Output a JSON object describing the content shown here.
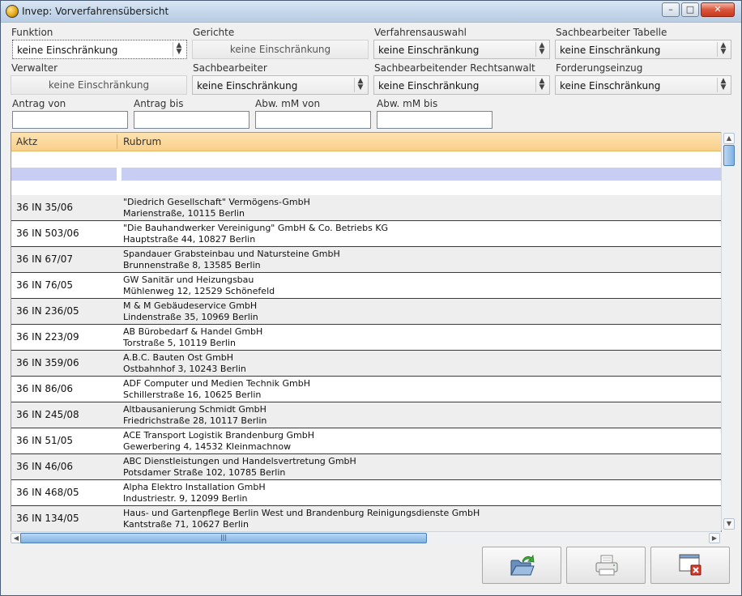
{
  "window": {
    "title": "Invep: Vorverfahrensübersicht"
  },
  "filters": {
    "funktion": {
      "label": "Funktion",
      "value": "keine Einschränkung"
    },
    "gerichte": {
      "label": "Gerichte",
      "value": "keine Einschränkung"
    },
    "verfahrensauswahl": {
      "label": "Verfahrensauswahl",
      "value": "keine Einschränkung"
    },
    "sachbearbeiter_tabelle": {
      "label": "Sachbearbeiter Tabelle",
      "value": "keine Einschränkung"
    },
    "verwalter": {
      "label": "Verwalter",
      "value": "keine Einschränkung"
    },
    "sachbearbeiter": {
      "label": "Sachbearbeiter",
      "value": "keine Einschränkung"
    },
    "sachbearbeitender_ra": {
      "label": "Sachbearbeitender Rechtsanwalt",
      "value": "keine Einschränkung"
    },
    "forderungseinzug": {
      "label": "Forderungseinzug",
      "value": "keine Einschränkung"
    },
    "antrag_von": {
      "label": "Antrag von",
      "value": ""
    },
    "antrag_bis": {
      "label": "Antrag bis",
      "value": ""
    },
    "abw_von": {
      "label": "Abw. mM von",
      "value": ""
    },
    "abw_bis": {
      "label": "Abw. mM bis",
      "value": ""
    }
  },
  "table": {
    "columns": [
      "Aktz",
      "Rubrum"
    ],
    "rows": [
      {
        "aktz": "36 IN 35/06",
        "line1": "\"Diedrich Gesellschaft\" Vermögens-GmbH",
        "line2": "Marienstraße, 10115 Berlin"
      },
      {
        "aktz": "36 IN 503/06",
        "line1": "\"Die Bauhandwerker Vereinigung\" GmbH & Co. Betriebs KG",
        "line2": "Hauptstraße 44, 10827 Berlin"
      },
      {
        "aktz": "36 IN 67/07",
        "line1": "Spandauer Grabsteinbau und Natursteine GmbH",
        "line2": "Brunnenstraße 8, 13585 Berlin"
      },
      {
        "aktz": "36 IN 76/05",
        "line1": "GW Sanitär und Heizungsbau",
        "line2": "Mühlenweg 12, 12529 Schönefeld"
      },
      {
        "aktz": "36 IN 236/05",
        "line1": "M & M Gebäudeservice GmbH",
        "line2": "Lindenstraße 35, 10969 Berlin"
      },
      {
        "aktz": "36 IN 223/09",
        "line1": "AB Bürobedarf & Handel GmbH",
        "line2": "Torstraße 5, 10119 Berlin"
      },
      {
        "aktz": "36 IN 359/06",
        "line1": "A.B.C. Bauten Ost GmbH",
        "line2": "Ostbahnhof 3, 10243 Berlin"
      },
      {
        "aktz": "36 IN 86/06",
        "line1": "ADF Computer und Medien Technik GmbH",
        "line2": "Schillerstraße 16, 10625 Berlin"
      },
      {
        "aktz": "36 IN 245/08",
        "line1": "Altbausanierung Schmidt GmbH",
        "line2": "Friedrichstraße 28, 10117 Berlin"
      },
      {
        "aktz": "36 IN 51/05",
        "line1": "ACE Transport Logistik Brandenburg GmbH",
        "line2": "Gewerbering 4, 14532 Kleinmachnow"
      },
      {
        "aktz": "36 IN 46/06",
        "line1": "ABC Dienstleistungen und Handelsvertretung GmbH",
        "line2": "Potsdamer Straße 102, 10785 Berlin"
      },
      {
        "aktz": "36 IN 468/05",
        "line1": "Alpha Elektro Installation GmbH",
        "line2": "Industriestr. 9, 12099 Berlin"
      },
      {
        "aktz": "36 IN 134/05",
        "line1": "Haus- und Gartenpflege Berlin West und Brandenburg Reinigungsdienste GmbH",
        "line2": "Kantstraße 71, 10627 Berlin"
      }
    ]
  },
  "buttons": {
    "open": {
      "icon": "folder-open-icon"
    },
    "print": {
      "icon": "printer-icon"
    },
    "close": {
      "icon": "window-close-icon"
    }
  }
}
